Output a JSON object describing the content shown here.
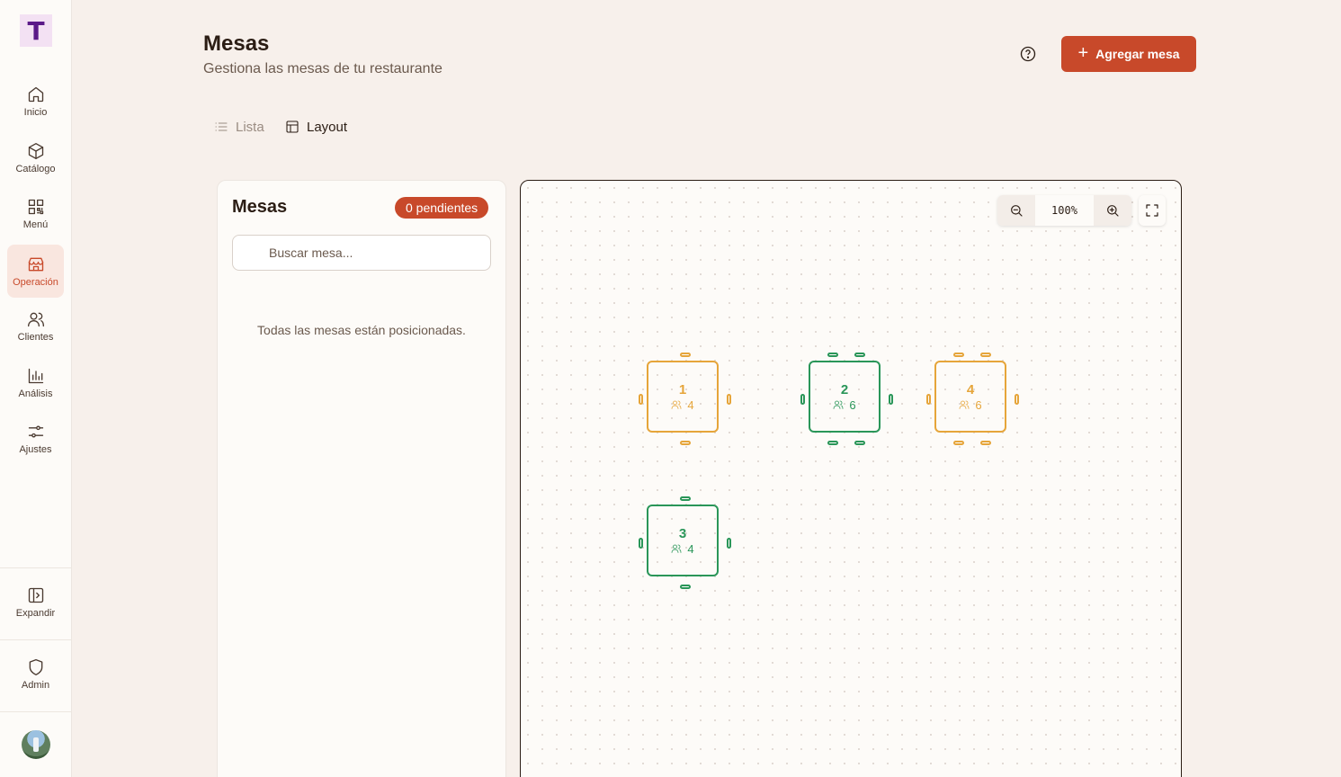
{
  "app": {
    "logo_letter": "T"
  },
  "sidebar": {
    "items": [
      {
        "label": "Inicio",
        "icon": "home-icon"
      },
      {
        "label": "Catálogo",
        "icon": "box-icon"
      },
      {
        "label": "Menú",
        "icon": "qr-code-icon"
      },
      {
        "label": "Operación",
        "icon": "store-icon",
        "active": true
      },
      {
        "label": "Clientes",
        "icon": "users-icon"
      },
      {
        "label": "Análisis",
        "icon": "bar-chart-icon"
      },
      {
        "label": "Ajustes",
        "icon": "sliders-icon"
      }
    ],
    "expand_label": "Expandir",
    "admin_label": "Admin"
  },
  "header": {
    "title": "Mesas",
    "subtitle": "Gestiona las mesas de tu restaurante",
    "add_button_label": "Agregar mesa"
  },
  "tabs": [
    {
      "label": "Lista",
      "active": false
    },
    {
      "label": "Layout",
      "active": true
    }
  ],
  "panel": {
    "title": "Mesas",
    "pending_badge": "0 pendientes",
    "search_placeholder": "Buscar mesa...",
    "empty_message": "Todas las mesas están posicionadas."
  },
  "canvas": {
    "zoom_label": "100%"
  },
  "tables": [
    {
      "number": "1",
      "capacity": "4",
      "status": "pending"
    },
    {
      "number": "2",
      "capacity": "6",
      "status": "free"
    },
    {
      "number": "4",
      "capacity": "6",
      "status": "pending"
    },
    {
      "number": "3",
      "capacity": "4",
      "status": "free"
    }
  ],
  "colors": {
    "accent": "#c8492a",
    "pending": "#e6a53a",
    "free": "#2a9659",
    "background": "#f7f0eb"
  }
}
